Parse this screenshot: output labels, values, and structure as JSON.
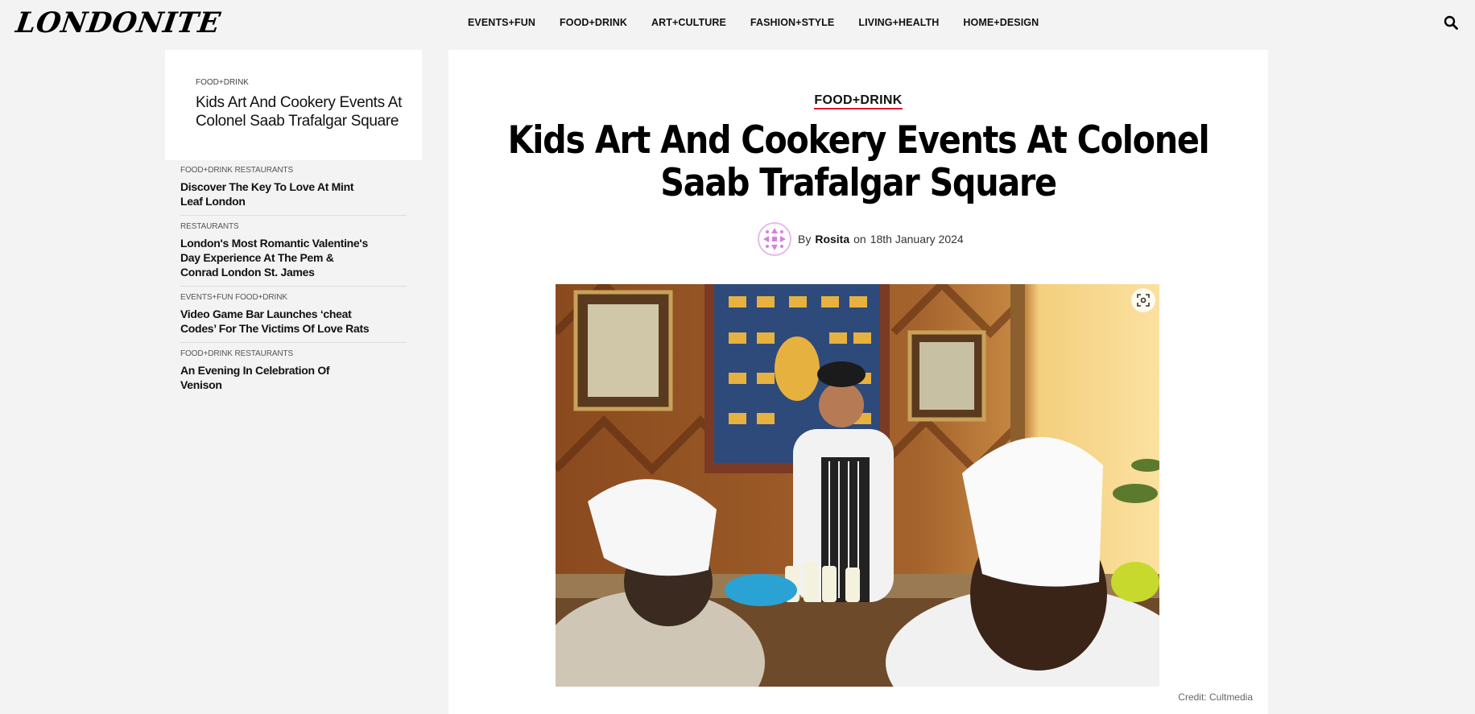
{
  "header": {
    "logo": "LONDONITE",
    "nav": [
      "EVENTS+FUN",
      "FOOD+DRINK",
      "ART+CULTURE",
      "FASHION+STYLE",
      "LIVING+HEALTH",
      "HOME+DESIGN"
    ]
  },
  "sidebar": {
    "current": {
      "category": "FOOD+DRINK",
      "title": "Kids Art And Cookery Events At Colonel Saab Trafalgar Square"
    },
    "items": [
      {
        "category": "FOOD+DRINK RESTAURANTS",
        "title": "Discover The Key To Love At Mint Leaf London"
      },
      {
        "category": "RESTAURANTS",
        "title": "London's Most Romantic Valentine's Day Experience At The Pem & Conrad London St. James"
      },
      {
        "category": "EVENTS+FUN FOOD+DRINK",
        "title": "Video Game Bar Launches ‘cheat Codes’ For The Victims Of Love Rats"
      },
      {
        "category": "FOOD+DRINK RESTAURANTS",
        "title": "An Evening In Celebration Of Venison"
      }
    ]
  },
  "article": {
    "category": "FOOD+DRINK",
    "title": "Kids Art And Cookery Events At Colonel Saab Trafalgar Square",
    "by": "By",
    "author": "Rosita",
    "on": "on",
    "date": "18th January 2024",
    "credit": "Credit: Cultmedia"
  },
  "colors": {
    "accent_red": "#e0192d",
    "avatar_ring": "#e9b8ef"
  }
}
